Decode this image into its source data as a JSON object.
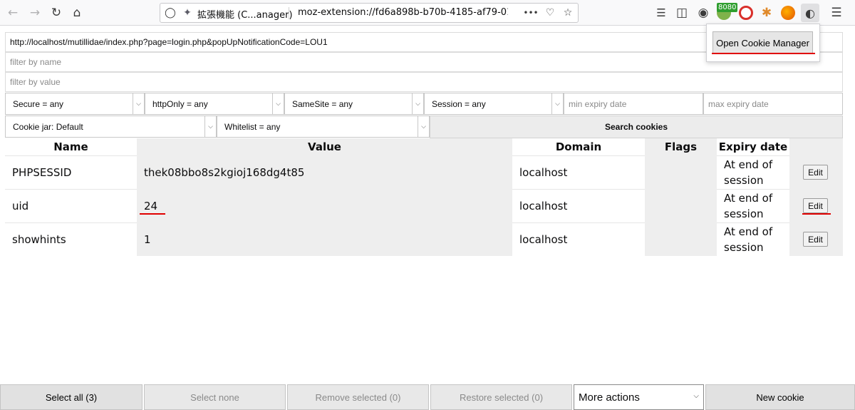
{
  "toolbar": {
    "tab_title": "拡張機能 (C...anager)",
    "url": "moz-extension://fd6a898b-b70b-4185-af79-017b6",
    "ext_badge": "8080"
  },
  "popup": {
    "open_label": "Open Cookie Manager"
  },
  "filters": {
    "url_value": "http://localhost/mutillidae/index.php?page=login.php&popUpNotificationCode=LOU1",
    "name_placeholder": "filter by name",
    "value_placeholder": "filter by value",
    "secure": "Secure = any",
    "httponly": "httpOnly = any",
    "samesite": "SameSite = any",
    "session": "Session = any",
    "min_expiry_placeholder": "min expiry date",
    "max_expiry_placeholder": "max expiry date",
    "cookie_jar": "Cookie jar: Default",
    "whitelist": "Whitelist = any",
    "search_label": "Search cookies"
  },
  "table": {
    "headers": {
      "name": "Name",
      "value": "Value",
      "domain": "Domain",
      "flags": "Flags",
      "expiry": "Expiry date"
    },
    "rows": [
      {
        "name": "PHPSESSID",
        "value": "thek08bbo8s2kgioj168dg4t85",
        "domain": "localhost",
        "flags": "",
        "expiry_line1": "At end of",
        "expiry_line2": "session",
        "edit": "Edit"
      },
      {
        "name": "uid",
        "value": "24",
        "domain": "localhost",
        "flags": "",
        "expiry_line1": "At end of",
        "expiry_line2": "session",
        "edit": "Edit"
      },
      {
        "name": "showhints",
        "value": "1",
        "domain": "localhost",
        "flags": "",
        "expiry_line1": "At end of",
        "expiry_line2": "session",
        "edit": "Edit"
      }
    ]
  },
  "bottom": {
    "select_all": "Select all (3)",
    "select_none": "Select none",
    "remove_selected": "Remove selected (0)",
    "restore_selected": "Restore selected (0)",
    "more_actions": "More actions",
    "new_cookie": "New cookie"
  },
  "colors": {
    "highlight_underline": "#e00000",
    "value_column_bg": "#eeeeee"
  }
}
